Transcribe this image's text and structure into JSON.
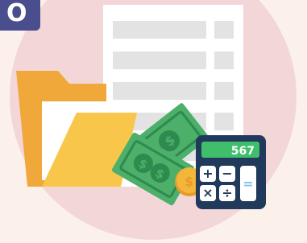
{
  "corner_tag": {
    "text": "O",
    "color": "#4a4e8f"
  },
  "calculator": {
    "display": "567",
    "keys": [
      "+",
      "−",
      "×",
      "÷",
      "="
    ]
  },
  "colors": {
    "background": "#fcf1ea",
    "circle": "#f3d6d8",
    "folder": "#f0a83a",
    "folder_front": "#f8c64a",
    "document": "#ffffff",
    "document_line": "#e3e3e3",
    "money_green": "#4caf6a",
    "money_dark": "#2e8a4e",
    "coin": "#f4b63a",
    "calculator_body": "#213a5c",
    "calculator_screen": "#3fbf6c",
    "calculator_key": "#ffffff",
    "calculator_equals": "#7fc6e8"
  },
  "icons": [
    "folder-icon",
    "document-icon",
    "banknote-icon",
    "coin-icon",
    "calculator-icon"
  ]
}
